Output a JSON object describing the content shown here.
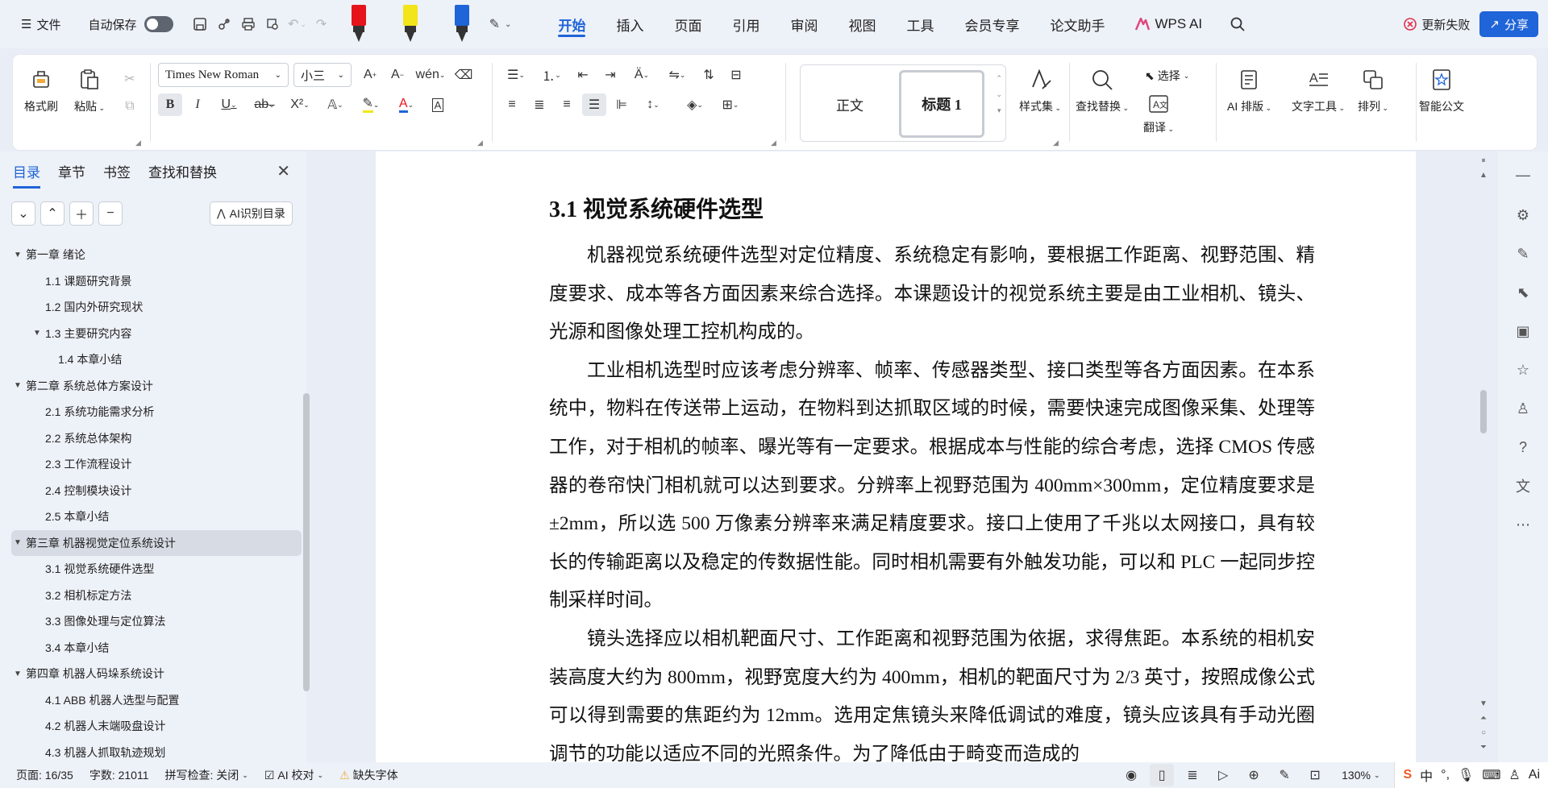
{
  "menubar": {
    "file_label": "文件",
    "autosave_label": "自动保存",
    "tabs": [
      "开始",
      "插入",
      "页面",
      "引用",
      "审阅",
      "视图",
      "工具",
      "会员专享",
      "论文助手"
    ],
    "active_tab": "开始",
    "wps_ai_label": "WPS AI",
    "update_failed_label": "更新失败",
    "share_label": "分享",
    "pen_colors": [
      "#e5141b",
      "#f2e51a",
      "#1f64d8"
    ]
  },
  "ribbon": {
    "format_painter": "格式刷",
    "paste": "粘贴",
    "font_name": "Times New Roman",
    "font_size": "小三",
    "style_normal": "正文",
    "style_heading": "标题 1",
    "style_set": "样式集",
    "find_replace": "查找替换",
    "select": "选择",
    "translate": "翻译",
    "ai_layout": "AI 排版",
    "text_tools": "文字工具",
    "arrange": "排列",
    "smart_doc": "智能公文",
    "bold": "B",
    "italic": "I",
    "underline": "U",
    "strike": "ab",
    "superscript": "X²",
    "font_color_char": "A"
  },
  "nav_panel": {
    "tabs": [
      "目录",
      "章节",
      "书签",
      "查找和替换"
    ],
    "active_tab": "目录",
    "ai_toc_label": "AI识别目录",
    "items": [
      {
        "level": 1,
        "caret": "down",
        "text": "第一章  绪论"
      },
      {
        "level": 2,
        "caret": "",
        "text": "1.1  课题研究背景"
      },
      {
        "level": 2,
        "caret": "",
        "text": "1.2  国内外研究现状"
      },
      {
        "level": 2,
        "caret": "down",
        "text": "1.3  主要研究内容"
      },
      {
        "level": 3,
        "caret": "",
        "text": "1.4  本章小结"
      },
      {
        "level": 1,
        "caret": "down",
        "text": "第二章  系统总体方案设计"
      },
      {
        "level": 2,
        "caret": "",
        "text": "2.1  系统功能需求分析"
      },
      {
        "level": 2,
        "caret": "",
        "text": "2.2  系统总体架构"
      },
      {
        "level": 2,
        "caret": "",
        "text": "2.3  工作流程设计"
      },
      {
        "level": 2,
        "caret": "",
        "text": "2.4  控制模块设计"
      },
      {
        "level": 2,
        "caret": "",
        "text": "2.5  本章小结"
      },
      {
        "level": 1,
        "caret": "down",
        "text": "第三章  机器视觉定位系统设计",
        "active": true
      },
      {
        "level": 2,
        "caret": "",
        "text": "3.1  视觉系统硬件选型"
      },
      {
        "level": 2,
        "caret": "",
        "text": "3.2  相机标定方法"
      },
      {
        "level": 2,
        "caret": "",
        "text": "3.3  图像处理与定位算法"
      },
      {
        "level": 2,
        "caret": "",
        "text": "3.4  本章小结"
      },
      {
        "level": 1,
        "caret": "down",
        "text": "第四章  机器人码垛系统设计"
      },
      {
        "level": 2,
        "caret": "",
        "text": "4.1 ABB 机器人选型与配置"
      },
      {
        "level": 2,
        "caret": "",
        "text": "4.2  机器人末端吸盘设计"
      },
      {
        "level": 2,
        "caret": "",
        "text": "4.3  机器人抓取轨迹规划"
      }
    ]
  },
  "document": {
    "heading": "3.1  视觉系统硬件选型",
    "paragraphs": [
      "机器视觉系统硬件选型对定位精度、系统稳定有影响，要根据工作距离、视野范围、精度要求、成本等各方面因素来综合选择。本课题设计的视觉系统主要是由工业相机、镜头、光源和图像处理工控机构成的。",
      "工业相机选型时应该考虑分辨率、帧率、传感器类型、接口类型等各方面因素。在本系统中，物料在传送带上运动，在物料到达抓取区域的时候，需要快速完成图像采集、处理等工作，对于相机的帧率、曝光等有一定要求。根据成本与性能的综合考虑，选择 CMOS 传感器的卷帘快门相机就可以达到要求。分辨率上视野范围为 400mm×300mm，定位精度要求是±2mm，所以选 500 万像素分辨率来满足精度要求。接口上使用了千兆以太网接口，具有较长的传输距离以及稳定的传数据性能。同时相机需要有外触发功能，可以和 PLC 一起同步控制采样时间。",
      "镜头选择应以相机靶面尺寸、工作距离和视野范围为依据，求得焦距。本系统的相机安装高度大约为 800mm，视野宽度大约为 400mm，相机的靶面尺寸为 2/3 英寸，按照成像公式可以得到需要的焦距约为 12mm。选用定焦镜头来降低调试的难度，镜头应该具有手动光圈调节的功能以适应不同的光照条件。为了降低由于畸变而造成的"
    ]
  },
  "statusbar": {
    "page": "页面: 16/35",
    "words": "字数: 21011",
    "spellcheck": "拼写检查: 关闭",
    "ai_proofread": "AI 校对",
    "missing_font": "缺失字体",
    "zoom": "130%",
    "ime_lang": "中"
  }
}
